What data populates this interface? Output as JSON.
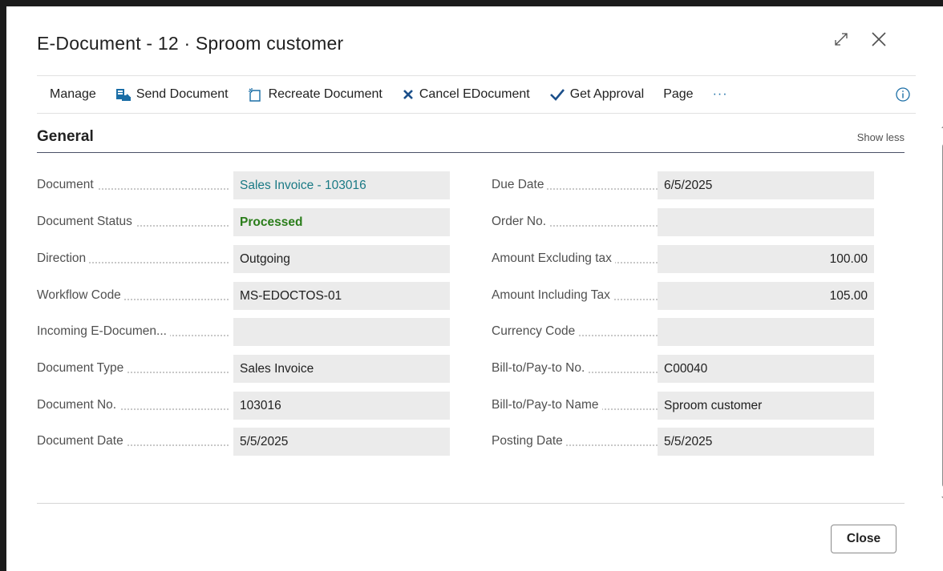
{
  "dialog": {
    "title": "E-Document - 12 · Sproom customer"
  },
  "toolbar": {
    "manage": "Manage",
    "send_document": "Send Document",
    "recreate_document": "Recreate Document",
    "cancel_edocument": "Cancel EDocument",
    "get_approval": "Get Approval",
    "page": "Page",
    "more": "···"
  },
  "section": {
    "title": "General",
    "show_less": "Show less"
  },
  "left_fields": [
    {
      "label": "Document",
      "value": "Sales Invoice - 103016"
    },
    {
      "label": "Document Status",
      "value": "Processed"
    },
    {
      "label": "Direction",
      "value": "Outgoing"
    },
    {
      "label": "Workflow Code",
      "value": "MS-EDOCTOS-01"
    },
    {
      "label": "Incoming E-Documen...",
      "value": ""
    },
    {
      "label": "Document Type",
      "value": "Sales Invoice"
    },
    {
      "label": "Document No.",
      "value": "103016"
    },
    {
      "label": "Document Date",
      "value": "5/5/2025"
    }
  ],
  "right_fields": [
    {
      "label": "Due Date",
      "value": "6/5/2025"
    },
    {
      "label": "Order No.",
      "value": ""
    },
    {
      "label": "Amount Excluding tax",
      "value": "100.00"
    },
    {
      "label": "Amount Including Tax",
      "value": "105.00"
    },
    {
      "label": "Currency Code",
      "value": ""
    },
    {
      "label": "Bill-to/Pay-to No.",
      "value": "C00040"
    },
    {
      "label": "Bill-to/Pay-to Name",
      "value": "Sproom customer"
    },
    {
      "label": "Posting Date",
      "value": "5/5/2025"
    }
  ],
  "footer": {
    "close_label": "Close"
  },
  "colors": {
    "link": "#1a7a85",
    "status_processed": "#2a7d1a",
    "field_bg": "#ebebeb"
  }
}
